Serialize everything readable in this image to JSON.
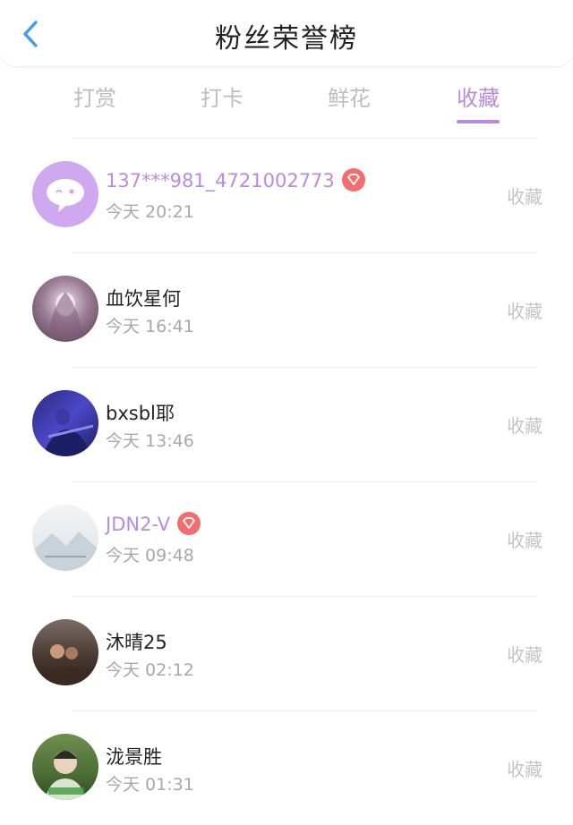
{
  "header": {
    "title": "粉丝荣誉榜",
    "back_icon": "chevron-left-icon",
    "accent": "#3d9bf2"
  },
  "tabs": [
    {
      "label": "打赏",
      "active": false
    },
    {
      "label": "打卡",
      "active": false
    },
    {
      "label": "鲜花",
      "active": false
    },
    {
      "label": "收藏",
      "active": true
    }
  ],
  "colors": {
    "active_tab": "#b88be0",
    "vip_name": "#b88be0",
    "badge": "#f26d6d"
  },
  "rows": [
    {
      "name": "137***981_4721002773",
      "time": "今天 20:21",
      "action": "收藏",
      "vip": true,
      "avatar": "chat-bubble-avatar"
    },
    {
      "name": "血饮星何",
      "time": "今天 16:41",
      "action": "收藏",
      "vip": false,
      "avatar": "girl-portrait-avatar"
    },
    {
      "name": "bxsbl耶",
      "time": "今天 13:46",
      "action": "收藏",
      "vip": false,
      "avatar": "guitar-avatar"
    },
    {
      "name": "JDN2-V",
      "time": "今天 09:48",
      "action": "收藏",
      "vip": true,
      "avatar": "mountain-avatar"
    },
    {
      "name": "沐晴25",
      "time": "今天 02:12",
      "action": "收藏",
      "vip": false,
      "avatar": "couple-avatar"
    },
    {
      "name": "泷景胜",
      "time": "今天 01:31",
      "action": "收藏",
      "vip": false,
      "avatar": "boy-portrait-avatar"
    }
  ]
}
